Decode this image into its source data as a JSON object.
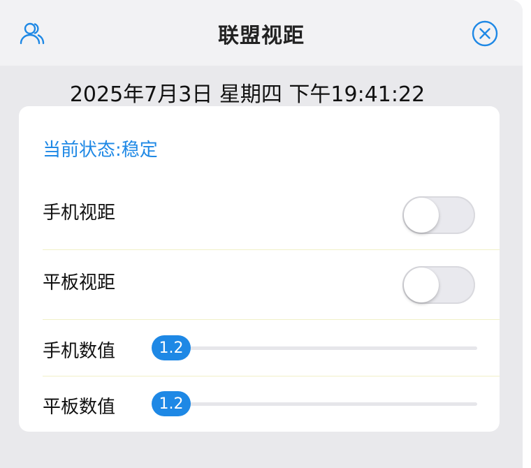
{
  "header": {
    "title": "联盟视距",
    "left_icon": "user-group-icon",
    "right_icon": "close-circle-icon",
    "accent_color": "#1e88e5"
  },
  "datetime": "2025年7月3日 星期四 下午19:41:22",
  "card": {
    "status": "当前状态:稳定",
    "rows": [
      {
        "label": "手机视距",
        "type": "toggle",
        "on": false
      },
      {
        "label": "平板视距",
        "type": "toggle",
        "on": false
      },
      {
        "label": "手机数值",
        "type": "slider",
        "value": "1.2",
        "position": 0
      },
      {
        "label": "平板数值",
        "type": "slider",
        "value": "1.2",
        "position": 0
      }
    ]
  }
}
